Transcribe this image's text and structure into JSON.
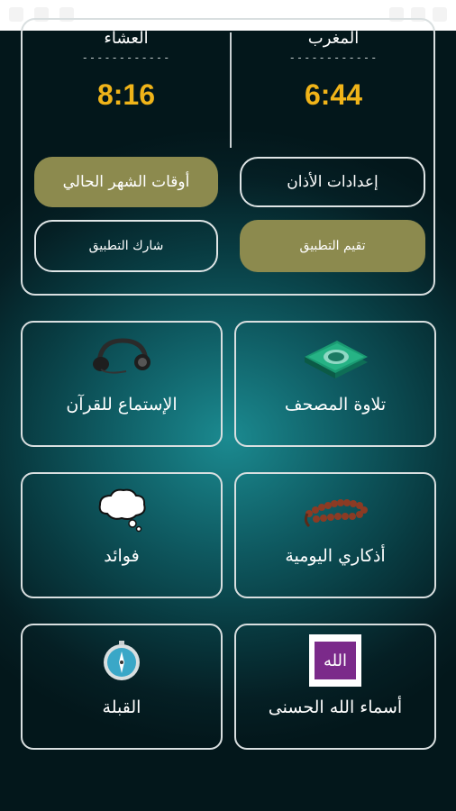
{
  "prayers": [
    {
      "name": "المغرب",
      "dashes": "------------",
      "time": "6:44"
    },
    {
      "name": "العشاء",
      "dashes": "------------",
      "time": "8:16"
    }
  ],
  "buttons": {
    "adhan_settings": "إعدادات الأذان",
    "month_times": "أوقات الشهر الحالي",
    "rate_app": "تقيم التطبيق",
    "share_app": "شارك التطبيق"
  },
  "tiles": [
    {
      "label": "تلاوة المصحف",
      "icon": "quran-book-icon"
    },
    {
      "label": "الإستماع للقرآن",
      "icon": "headphones-icon"
    },
    {
      "label": "أذكاري اليومية",
      "icon": "prayer-beads-icon"
    },
    {
      "label": "فوائد",
      "icon": "thought-cloud-icon"
    },
    {
      "label": "أسماء الله الحسنى",
      "icon": "allah-calligraphy-icon"
    },
    {
      "label": "القبلة",
      "icon": "compass-icon"
    }
  ],
  "allah_badge_text": "الله",
  "colors": {
    "accent_gold": "#f0b419",
    "button_gold": "#8c8a4e",
    "background_teal": "#0f5c63"
  }
}
